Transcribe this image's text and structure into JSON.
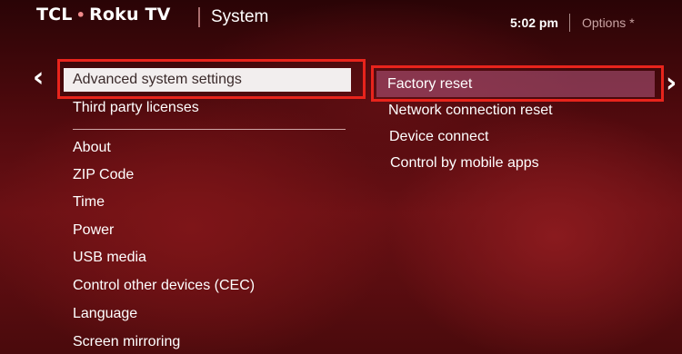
{
  "header": {
    "brand_tcl": "TCL",
    "brand_dot": "•",
    "brand_roku": "Roku TV",
    "section_title": "System",
    "time": "5:02 pm",
    "options_label": "Options",
    "options_icon": "*"
  },
  "nav": {
    "left_arrow": "‹",
    "right_arrow": "›"
  },
  "left_menu": {
    "selected": "Advanced system settings",
    "items_top": [
      "Third party licenses"
    ],
    "items": [
      "About",
      "ZIP Code",
      "Time",
      "Power",
      "USB media",
      "Control other devices (CEC)",
      "Language",
      "Screen mirroring"
    ]
  },
  "right_menu": {
    "items": [
      "Factory reset",
      "Network connection reset",
      "Device connect",
      "Control by mobile apps"
    ]
  },
  "colors": {
    "highlight_box": "#e8241c",
    "selected_bg": "#f2eeee",
    "right_selected_bg": "#b45a82"
  }
}
